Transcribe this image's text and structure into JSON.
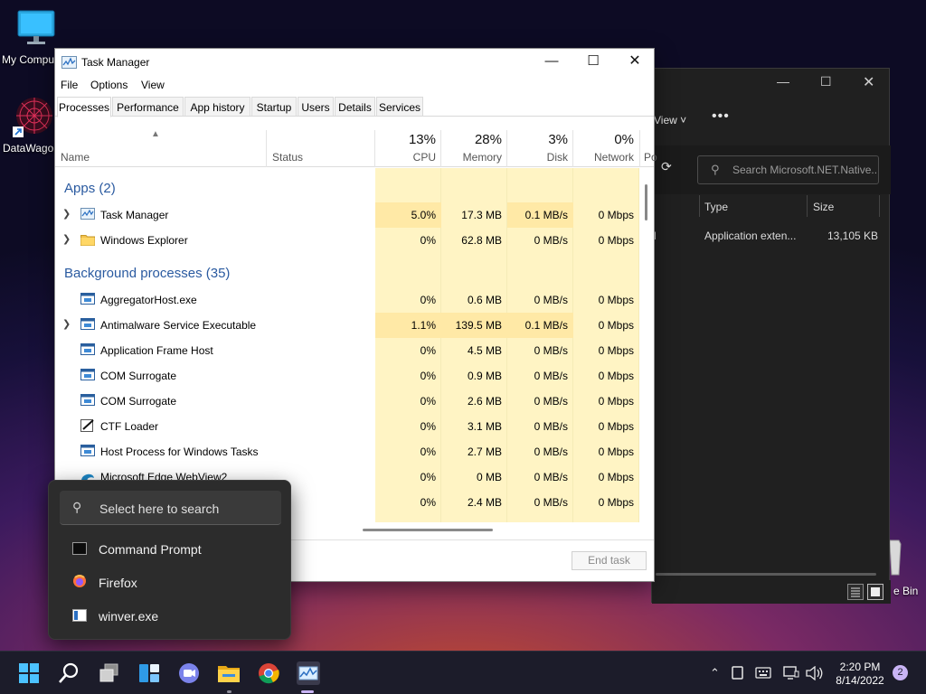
{
  "desktop": {
    "icons": [
      {
        "label": "My Compu"
      },
      {
        "label": "DataWagor"
      }
    ],
    "recycle_bin_label": "e Bin"
  },
  "explorer": {
    "view_label": "View ˅",
    "more_label": "•••",
    "search_placeholder": "Search Microsoft.NET.Native...",
    "columns": {
      "type": "Type",
      "size": "Size"
    },
    "row": {
      "first_char": "l",
      "type": "Application exten...",
      "size": "13,105 KB"
    }
  },
  "taskmanager": {
    "title": "Task Manager",
    "menu": [
      "File",
      "Options",
      "View"
    ],
    "tabs": [
      "Processes",
      "Performance",
      "App history",
      "Startup",
      "Users",
      "Details",
      "Services"
    ],
    "active_tab": "Processes",
    "columns": {
      "name": "Name",
      "status": "Status",
      "cpu": {
        "pct": "13%",
        "label": "CPU"
      },
      "memory": {
        "pct": "28%",
        "label": "Memory"
      },
      "disk": {
        "pct": "3%",
        "label": "Disk"
      },
      "network": {
        "pct": "0%",
        "label": "Network"
      },
      "power_cut": "Po"
    },
    "groups": {
      "apps": "Apps (2)",
      "background": "Background processes (35)"
    },
    "apps": [
      {
        "name": "Task Manager",
        "cpu": "5.0%",
        "memory": "17.3 MB",
        "disk": "0.1 MB/s",
        "network": "0 Mbps",
        "expand": true
      },
      {
        "name": "Windows Explorer",
        "cpu": "0%",
        "memory": "62.8 MB",
        "disk": "0 MB/s",
        "network": "0 Mbps",
        "expand": true
      }
    ],
    "background": [
      {
        "name": "AggregatorHost.exe",
        "cpu": "0%",
        "memory": "0.6 MB",
        "disk": "0 MB/s",
        "network": "0 Mbps",
        "expand": false
      },
      {
        "name": "Antimalware Service Executable",
        "cpu": "1.1%",
        "memory": "139.5 MB",
        "disk": "0.1 MB/s",
        "network": "0 Mbps",
        "expand": true
      },
      {
        "name": "Application Frame Host",
        "cpu": "0%",
        "memory": "4.5 MB",
        "disk": "0 MB/s",
        "network": "0 Mbps",
        "expand": false
      },
      {
        "name": "COM Surrogate",
        "cpu": "0%",
        "memory": "0.9 MB",
        "disk": "0 MB/s",
        "network": "0 Mbps",
        "expand": false
      },
      {
        "name": "COM Surrogate",
        "cpu": "0%",
        "memory": "2.6 MB",
        "disk": "0 MB/s",
        "network": "0 Mbps",
        "expand": false
      },
      {
        "name": "CTF Loader",
        "cpu": "0%",
        "memory": "3.1 MB",
        "disk": "0 MB/s",
        "network": "0 Mbps",
        "expand": false
      },
      {
        "name": "Host Process for Windows Tasks",
        "cpu": "0%",
        "memory": "2.7 MB",
        "disk": "0 MB/s",
        "network": "0 Mbps",
        "expand": false
      },
      {
        "name": "Microsoft Edge WebView2",
        "cpu": "0%",
        "memory": "0 MB",
        "disk": "0 MB/s",
        "network": "0 Mbps",
        "expand": false
      },
      {
        "name": "",
        "cpu": "0%",
        "memory": "2.4 MB",
        "disk": "0 MB/s",
        "network": "0 Mbps",
        "expand": false
      }
    ],
    "end_task_label": "End task"
  },
  "flyout": {
    "search_placeholder": "Select here to search",
    "items": [
      "Command Prompt",
      "Firefox",
      "winver.exe"
    ]
  },
  "taskbar": {
    "time": "2:20 PM",
    "date": "8/14/2022",
    "notification_count": "2"
  }
}
